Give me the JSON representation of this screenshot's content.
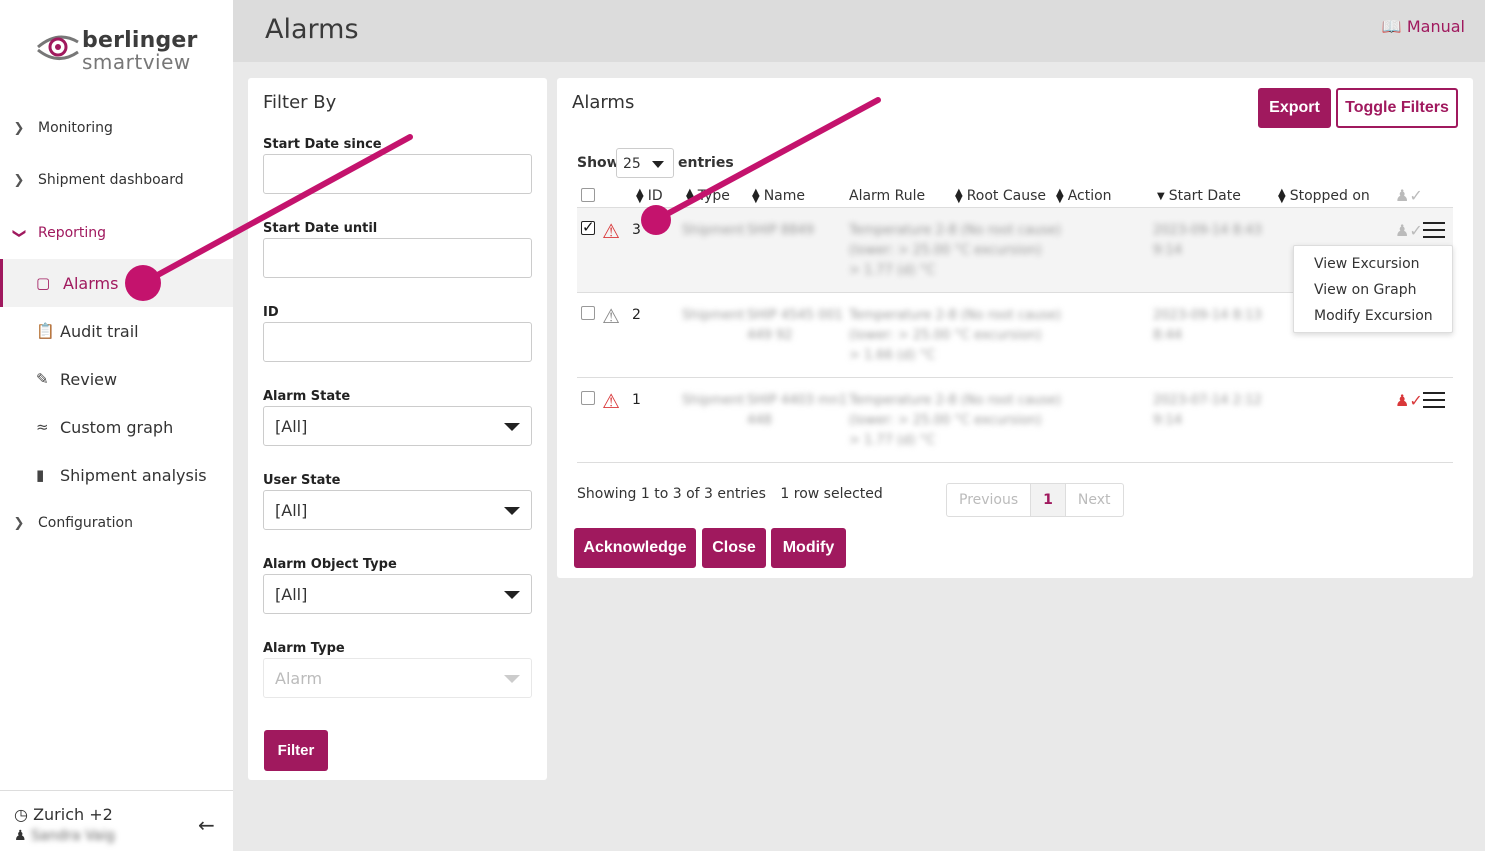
{
  "brand": {
    "name_top": "berlinger",
    "name_bottom": "smartview"
  },
  "header": {
    "title": "Alarms",
    "manual_label": "Manual"
  },
  "sidebar": {
    "items": [
      {
        "label": "Monitoring"
      },
      {
        "label": "Shipment dashboard"
      },
      {
        "label": "Reporting"
      },
      {
        "label": "Configuration"
      }
    ],
    "reporting_sub": [
      {
        "label": "Alarms",
        "icon": "alert-square-icon"
      },
      {
        "label": "Audit trail",
        "icon": "clipboard-icon"
      },
      {
        "label": "Review",
        "icon": "review-icon"
      },
      {
        "label": "Custom graph",
        "icon": "custom-graph-icon"
      },
      {
        "label": "Shipment analysis",
        "icon": "bar-chart-icon"
      }
    ],
    "timezone": "Zurich +2",
    "user_name": "Sandra Vaig"
  },
  "filter": {
    "title": "Filter By",
    "start_since_label": "Start Date since",
    "start_until_label": "Start Date until",
    "id_label": "ID",
    "alarm_state_label": "Alarm State",
    "alarm_state_value": "[All]",
    "user_state_label": "User State",
    "user_state_value": "[All]",
    "object_type_label": "Alarm Object Type",
    "object_type_value": "[All]",
    "alarm_type_label": "Alarm Type",
    "alarm_type_value": "Alarm",
    "filter_button": "Filter"
  },
  "alarms": {
    "title": "Alarms",
    "export_button": "Export",
    "toggle_filters_button": "Toggle Filters",
    "show_label": "Show",
    "show_value": "25",
    "entries_label": "entries",
    "columns": [
      "ID",
      "Type",
      "Name",
      "Alarm Rule",
      "Root Cause",
      "Action",
      "Start Date",
      "Stopped on"
    ],
    "rows": [
      {
        "id": "3",
        "severity": "red",
        "selected": true,
        "type_blur": "Shipment",
        "name_blur": "SHIP 8849",
        "rule_blur_1": "Temperature 2-8 (No root cause)",
        "rule_blur_2": "(lower: > 25.00 °C excursion)",
        "rule_blur_3": "> 1.77 (d) °C",
        "start_blur_1": "2023-09-14 8:43",
        "start_blur_2": "9:14"
      },
      {
        "id": "2",
        "severity": "grey",
        "selected": false,
        "type_blur": "Shipment",
        "name_blur": "SHIP 4545 001",
        "name_blur_2": "449 92",
        "rule_blur_1": "Temperature 2-8 (No root cause)",
        "rule_blur_2": "(lower: > 25.00 °C excursion)",
        "rule_blur_3": "> 1.66 (d) °C",
        "start_blur_1": "2023-09-14 8:13",
        "start_blur_2": "8:44"
      },
      {
        "id": "1",
        "severity": "red",
        "selected": false,
        "type_blur": "Shipment",
        "name_blur": "SHIP 4403 mn1",
        "name_blur_2": "448",
        "rule_blur_1": "Temperature 2-8 (No root cause)",
        "rule_blur_2": "(lower: > 25.00 °C excursion)",
        "rule_blur_3": "> 1.77 (d) °C",
        "start_blur_1": "2023-07-14 2:12",
        "start_blur_2": "9:14"
      }
    ],
    "context_menu": [
      "View Excursion",
      "View on Graph",
      "Modify Excursion"
    ],
    "info": "Showing 1 to 3 of 3 entries",
    "selected_info": "1 row selected",
    "pager": {
      "prev": "Previous",
      "current": "1",
      "next": "Next"
    },
    "acknowledge_button": "Acknowledge",
    "close_button": "Close",
    "modify_button": "Modify"
  },
  "colors": {
    "accent": "#a0195e",
    "alarm_red": "#d9383a",
    "header_bg": "#dcdcdc"
  }
}
